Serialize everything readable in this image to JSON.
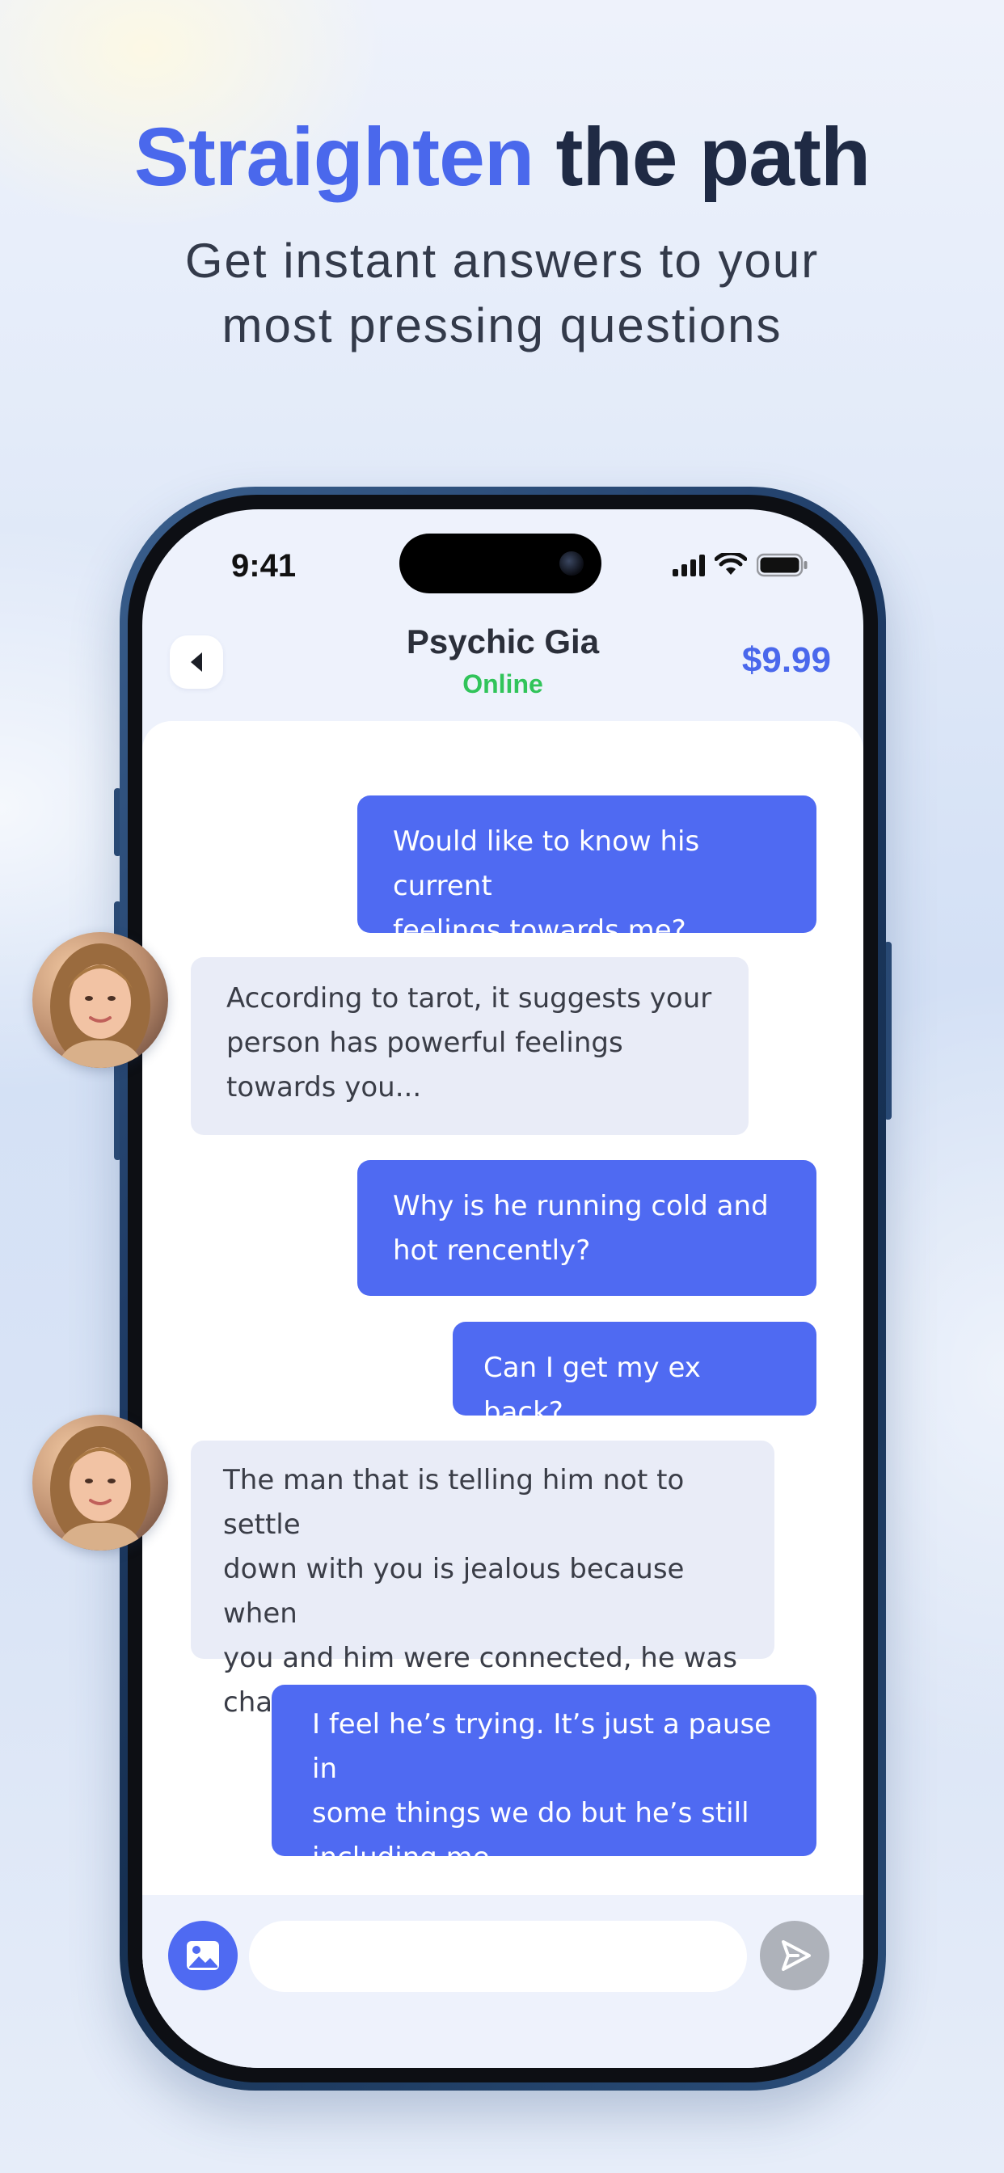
{
  "promo": {
    "headline_accent": "Straighten",
    "headline_rest": " the path",
    "subtitle_line1": "Get instant answers to your",
    "subtitle_line2": "most pressing questions"
  },
  "status_bar": {
    "time": "9:41",
    "icons": [
      "cellular-signal-icon",
      "wifi-icon",
      "battery-icon"
    ]
  },
  "chat_header": {
    "back_icon": "back-arrow-icon",
    "name": "Psychic Gia",
    "status": "Online",
    "price": "$9.99"
  },
  "messages": [
    {
      "from": "user",
      "lines": [
        "Would like to know his current",
        "feelings towards me?"
      ]
    },
    {
      "from": "psychic",
      "lines": [
        "According to tarot, it suggests your",
        "person has powerful feelings",
        "towards you..."
      ]
    },
    {
      "from": "user",
      "lines": [
        "Why is he running cold and",
        "hot rencently?"
      ]
    },
    {
      "from": "user",
      "lines": [
        "Can I get my ex back?"
      ]
    },
    {
      "from": "psychic",
      "lines": [
        "The man that is telling him not to settle",
        "down with you is jealous because when",
        "you and him were connected, he was",
        "changing for the better"
      ]
    },
    {
      "from": "user",
      "lines": [
        "I feel he’s trying. It’s just a pause in",
        "some things we do but he’s still",
        "including me"
      ]
    }
  ],
  "composer": {
    "image_icon": "image-icon",
    "input_value": "",
    "send_icon": "send-icon"
  },
  "colors": {
    "accent": "#4a68ec",
    "user_bubble": "#4f6af2",
    "psychic_bubble": "#e9ecf7",
    "online": "#31c45a",
    "send_disabled": "#aeb2ba"
  }
}
